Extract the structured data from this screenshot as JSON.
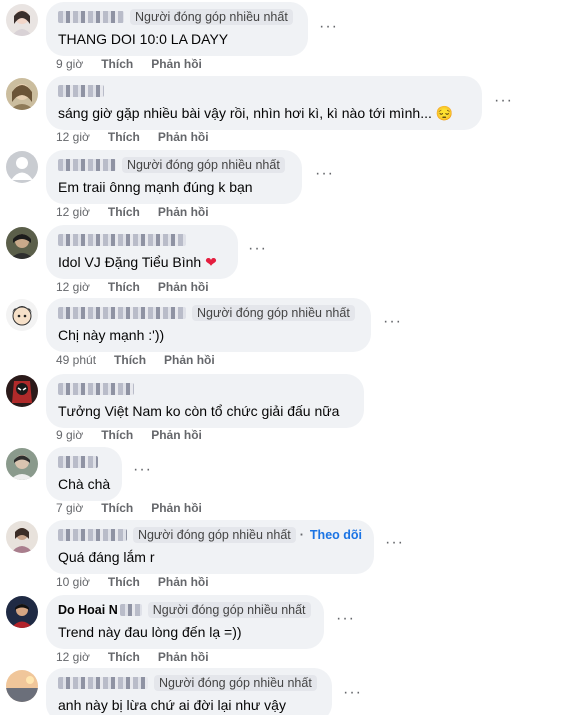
{
  "badge_label": "Người đóng góp nhiều nhất",
  "follow_label": "Theo dõi",
  "like_label": "Thích",
  "reply_label": "Phản hồi",
  "more_label": "···",
  "comments": [
    {
      "name": "",
      "text": "THANG DOI 10:0 LA DAYY",
      "time": "9 giờ",
      "badge": true
    },
    {
      "name": "",
      "text": "sáng giờ gặp nhiều bài vậy rồi, nhìn hơi kì, kì nào tới mình... 😔",
      "time": "12 giờ",
      "badge": false
    },
    {
      "name": "",
      "text": "Em traii ônng mạnh đúng k bạn",
      "time": "12 giờ",
      "badge": true
    },
    {
      "name": "",
      "text": "Idol VJ Đặng Tiểu Bình",
      "emoji": "❤",
      "time": "12 giờ",
      "badge": false
    },
    {
      "name": "",
      "text": "Chị này mạnh :'))",
      "time": "49 phút",
      "badge": true
    },
    {
      "name": "",
      "text": "Tưởng Việt Nam ko còn tổ chức giải đấu nữa",
      "time": "9 giờ",
      "badge": false
    },
    {
      "name": "",
      "text": "Chà chà",
      "time": "7 giờ",
      "badge": false
    },
    {
      "name": "",
      "text": "Quá đáng lắm r",
      "time": "10 giờ",
      "badge": true,
      "follow": true
    },
    {
      "name": "Do Hoai N",
      "text": "Trend này đau lòng đến lạ =))",
      "time": "12 giờ",
      "badge": true
    },
    {
      "name": "",
      "text": "anh này bị lừa chứ ai đời lại như vậy",
      "time": "",
      "badge": true
    }
  ]
}
